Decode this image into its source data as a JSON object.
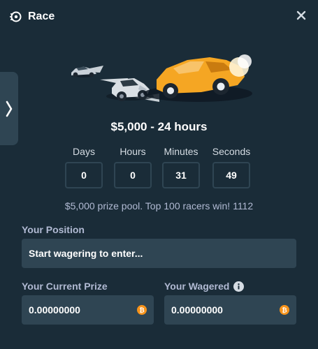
{
  "header": {
    "title": "Race",
    "race_icon": "race-logo-icon",
    "close_icon": "close-icon"
  },
  "side_tab": {
    "icon": "chevron-right-icon"
  },
  "banner": {
    "illustration": "race-cars-illustration"
  },
  "prize": {
    "title": "$5,000 - 24 hours"
  },
  "countdown": [
    {
      "label": "Days",
      "value": "0"
    },
    {
      "label": "Hours",
      "value": "0"
    },
    {
      "label": "Minutes",
      "value": "31"
    },
    {
      "label": "Seconds",
      "value": "49"
    }
  ],
  "pool_text": "$5,000 prize pool. Top 100 racers win! 1112",
  "position": {
    "label": "Your Position",
    "value": "Start wagering to enter..."
  },
  "current_prize": {
    "label": "Your Current Prize",
    "value": "0.00000000",
    "currency_icon": "bitcoin-icon"
  },
  "wagered": {
    "label": "Your Wagered",
    "value": "0.00000000",
    "info_icon": "info-icon",
    "currency_icon": "bitcoin-icon"
  },
  "colors": {
    "background": "#1a2c38",
    "surface": "#2f4553",
    "muted_text": "#b1bad3",
    "bitcoin": "#f7931a",
    "car_orange": "#f5a623"
  }
}
